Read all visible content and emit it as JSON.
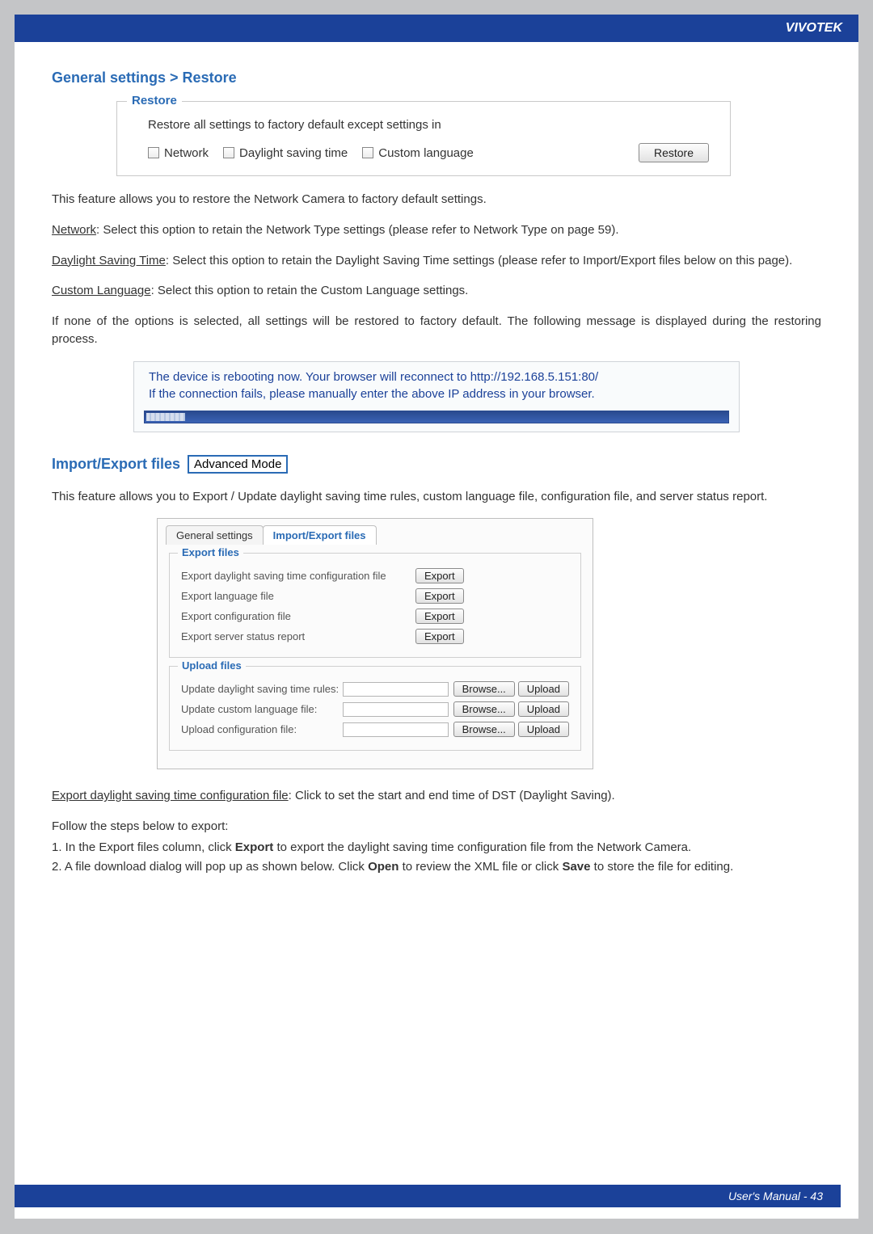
{
  "header": {
    "brand": "VIVOTEK"
  },
  "sections": {
    "restore_title": "General settings > Restore",
    "restore_panel": {
      "legend": "Restore",
      "description": "Restore all settings to factory default except settings in",
      "checkboxes": {
        "network": "Network",
        "dst": "Daylight saving time",
        "customlang": "Custom language"
      },
      "button": "Restore"
    },
    "restore_text": {
      "intro": "This feature allows you to restore the Network Camera to factory default settings.",
      "network_label": "Network",
      "network_body": ": Select this option to retain the Network Type settings (please refer to Network Type on page 59).",
      "dst_label": "Daylight Saving Time",
      "dst_body": ": Select this option to retain the Daylight Saving Time settings (please refer to Import/Export files below on this page).",
      "cl_label": "Custom Language",
      "cl_body": ": Select this option to retain the Custom Language settings.",
      "none": "If none of the options is selected, all settings will be restored to factory default.  The following message is displayed during the restoring process."
    },
    "reboot_box": {
      "line1": "The device is rebooting now. Your browser will reconnect to http://192.168.5.151:80/",
      "line2": "If the connection fails, please manually enter the above IP address in your browser."
    },
    "ie_title": "Import/Export files",
    "ie_badge": "Advanced Mode",
    "ie_intro": "This feature allows you to Export / Update daylight saving time rules, custom language file, configuration file, and server status report.",
    "tabs": {
      "general": "General settings",
      "ie": "Import/Export files"
    },
    "export_panel": {
      "legend": "Export files",
      "rows": {
        "dst": "Export daylight saving time configuration file",
        "lang": "Export language file",
        "conf": "Export configuration file",
        "status": "Export server status report"
      },
      "button": "Export"
    },
    "upload_panel": {
      "legend": "Upload files",
      "rows": {
        "dst": "Update daylight saving time rules:",
        "lang": "Update custom language file:",
        "conf": "Upload configuration file:"
      },
      "browse": "Browse...",
      "upload": "Upload"
    },
    "export_instructions": {
      "heading_label": "Export daylight saving time configuration file",
      "heading_body": ": Click to set the start and end time of DST (Daylight Saving).",
      "follow": "Follow the steps below to export:",
      "step1_a": "1. In the Export files column, click ",
      "step1_b": "Export",
      "step1_c": " to export the daylight saving time configuration file from the Network Camera.",
      "step2_a": "2. A file download dialog will pop up as shown below. Click ",
      "step2_b": "Open",
      "step2_c": " to review the XML file or click ",
      "step2_d": "Save",
      "step2_e": " to store the file for editing."
    }
  },
  "footer": {
    "text": "User's Manual - 43"
  }
}
